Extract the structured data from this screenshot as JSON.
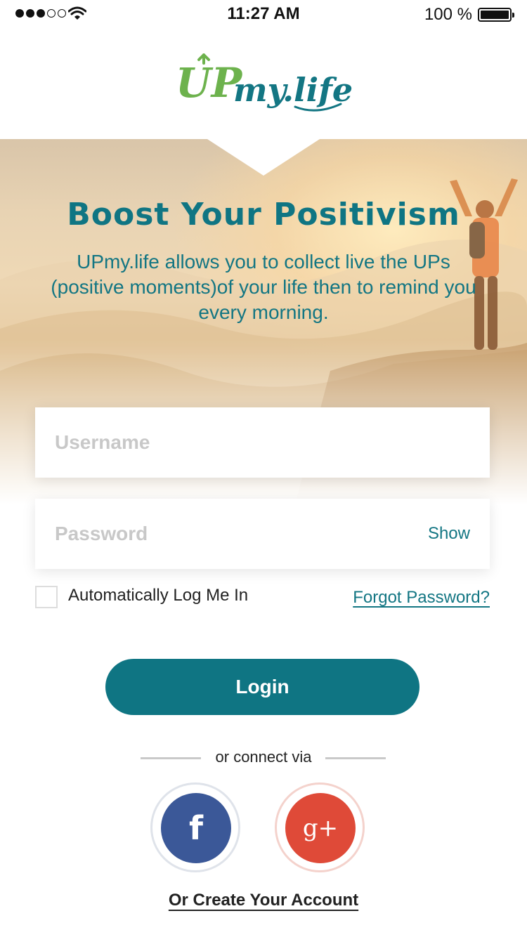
{
  "status_bar": {
    "time": "11:27 AM",
    "battery_percent": "100 %",
    "signal_bars_filled": 3,
    "signal_bars_total": 5
  },
  "brand": {
    "logo_up": "UP",
    "logo_mylife": "my.life",
    "colors": {
      "green": "#6db24d",
      "teal": "#0f7583"
    }
  },
  "hero": {
    "headline": "Boost Your Positivism",
    "description": "UPmy.life allows you to collect live the UPs (positive moments)of your life then to remind you every morning."
  },
  "form": {
    "username_placeholder": "Username",
    "password_placeholder": "Password",
    "show_label": "Show",
    "remember_label": "Automatically Log Me In",
    "forgot_label": "Forgot Password?",
    "login_label": "Login"
  },
  "social": {
    "divider_text": "or connect via",
    "facebook_glyph": "f",
    "google_glyph": "g+",
    "facebook_color": "#3b5898",
    "google_color": "#df4a38"
  },
  "footer": {
    "create_account": "Or Create Your Account"
  }
}
